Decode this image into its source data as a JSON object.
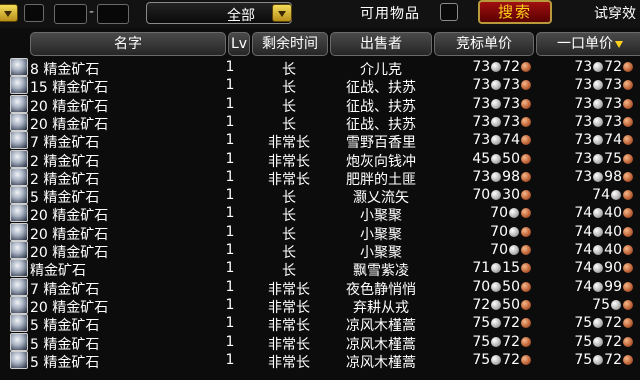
{
  "filter": {
    "category_value": "全部",
    "usable_label": "可用物品",
    "search_label": "搜索",
    "try_label": "试穿效"
  },
  "columns": {
    "name": "名字",
    "lv": "Lv",
    "time": "剩余时间",
    "seller": "出售者",
    "bid": "竞标单价",
    "buyout": "一口单价"
  },
  "rows": [
    {
      "qty": "8",
      "item": "精金矿石",
      "lv": "1",
      "time": "长",
      "seller": "介儿克",
      "bid_s": "73",
      "bid_c": "72",
      "buy_s": "73",
      "buy_c": "72"
    },
    {
      "qty": "15",
      "item": "精金矿石",
      "lv": "1",
      "time": "长",
      "seller": "征战、扶苏",
      "bid_s": "73",
      "bid_c": "73",
      "buy_s": "73",
      "buy_c": "73"
    },
    {
      "qty": "20",
      "item": "精金矿石",
      "lv": "1",
      "time": "长",
      "seller": "征战、扶苏",
      "bid_s": "73",
      "bid_c": "73",
      "buy_s": "73",
      "buy_c": "73"
    },
    {
      "qty": "20",
      "item": "精金矿石",
      "lv": "1",
      "time": "长",
      "seller": "征战、扶苏",
      "bid_s": "73",
      "bid_c": "73",
      "buy_s": "73",
      "buy_c": "73"
    },
    {
      "qty": "7",
      "item": "精金矿石",
      "lv": "1",
      "time": "非常长",
      "seller": "雪野百香里",
      "bid_s": "73",
      "bid_c": "74",
      "buy_s": "73",
      "buy_c": "74"
    },
    {
      "qty": "2",
      "item": "精金矿石",
      "lv": "1",
      "time": "非常长",
      "seller": "炮灰向钱冲",
      "bid_s": "45",
      "bid_c": "50",
      "buy_s": "73",
      "buy_c": "75"
    },
    {
      "qty": "2",
      "item": "精金矿石",
      "lv": "1",
      "time": "非常长",
      "seller": "肥胖的土匪",
      "bid_s": "73",
      "bid_c": "98",
      "buy_s": "73",
      "buy_c": "98"
    },
    {
      "qty": "5",
      "item": "精金矿石",
      "lv": "1",
      "time": "长",
      "seller": "灏乂流矢",
      "bid_s": "70",
      "bid_c": "30",
      "buy_s": "74",
      "buy_c": ""
    },
    {
      "qty": "20",
      "item": "精金矿石",
      "lv": "1",
      "time": "长",
      "seller": "小聚聚",
      "bid_s": "70",
      "bid_c": "",
      "buy_s": "74",
      "buy_c": "40"
    },
    {
      "qty": "20",
      "item": "精金矿石",
      "lv": "1",
      "time": "长",
      "seller": "小聚聚",
      "bid_s": "70",
      "bid_c": "",
      "buy_s": "74",
      "buy_c": "40"
    },
    {
      "qty": "20",
      "item": "精金矿石",
      "lv": "1",
      "time": "长",
      "seller": "小聚聚",
      "bid_s": "70",
      "bid_c": "",
      "buy_s": "74",
      "buy_c": "40"
    },
    {
      "qty": "",
      "item": "精金矿石",
      "lv": "1",
      "time": "长",
      "seller": "飘雪紫凌",
      "bid_s": "71",
      "bid_c": "15",
      "buy_s": "74",
      "buy_c": "90"
    },
    {
      "qty": "7",
      "item": "精金矿石",
      "lv": "1",
      "time": "非常长",
      "seller": "夜色静悄悄",
      "bid_s": "70",
      "bid_c": "50",
      "buy_s": "74",
      "buy_c": "99"
    },
    {
      "qty": "20",
      "item": "精金矿石",
      "lv": "1",
      "time": "非常长",
      "seller": "弃耕从戎",
      "bid_s": "72",
      "bid_c": "50",
      "buy_s": "75",
      "buy_c": ""
    },
    {
      "qty": "5",
      "item": "精金矿石",
      "lv": "1",
      "time": "非常长",
      "seller": "凉风木槿蒿",
      "bid_s": "75",
      "bid_c": "72",
      "buy_s": "75",
      "buy_c": "72"
    },
    {
      "qty": "5",
      "item": "精金矿石",
      "lv": "1",
      "time": "非常长",
      "seller": "凉风木槿蒿",
      "bid_s": "75",
      "bid_c": "72",
      "buy_s": "75",
      "buy_c": "72"
    },
    {
      "qty": "5",
      "item": "精金矿石",
      "lv": "1",
      "time": "非常长",
      "seller": "凉风木槿蒿",
      "bid_s": "75",
      "bid_c": "72",
      "buy_s": "75",
      "buy_c": "72"
    }
  ],
  "icons": {
    "row_icon": "adamantite-ore-icon",
    "silver_coin": "silver-coin-icon",
    "copper_coin": "copper-coin-icon",
    "dropdown_arrow": "chevron-down-icon",
    "sort_arrow": "sort-desc-icon"
  },
  "colors": {
    "accent_gold": "#ffd21a",
    "search_red": "#8a0a0a",
    "text": "#ffffff",
    "copper": "#c0663a",
    "silver": "#b8b8b8"
  }
}
